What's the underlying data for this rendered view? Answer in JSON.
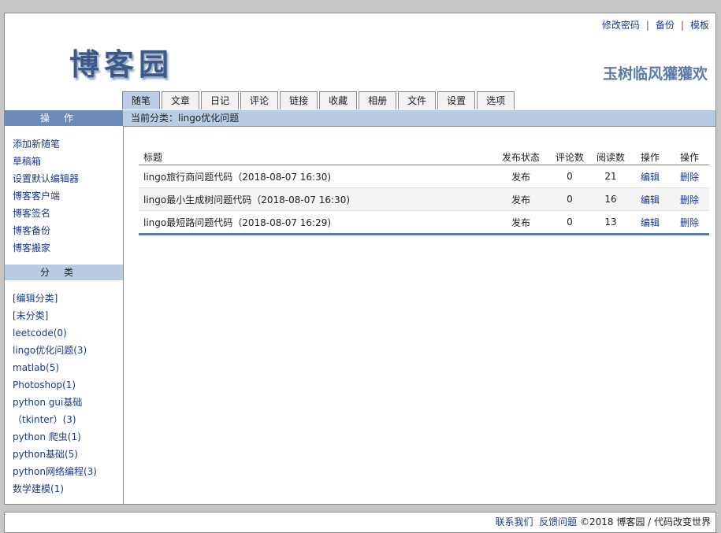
{
  "header": {
    "links": [
      "修改密码",
      "备份",
      "模板"
    ],
    "logo": "博客园",
    "blog_name": "玉树临风獾獾欢"
  },
  "tabs": [
    {
      "label": "随笔",
      "active": true
    },
    {
      "label": "文章"
    },
    {
      "label": "日记"
    },
    {
      "label": "评论"
    },
    {
      "label": "链接"
    },
    {
      "label": "收藏"
    },
    {
      "label": "相册"
    },
    {
      "label": "文件"
    },
    {
      "label": "设置"
    },
    {
      "label": "选项"
    }
  ],
  "sidebar": {
    "ops_header": "操作",
    "ops": [
      "添加新随笔",
      "草稿箱",
      "设置默认编辑器",
      "博客客户端",
      "博客签名",
      "博客备份",
      "博客搬家"
    ],
    "cat_header": "分类",
    "cats": [
      "[编辑分类]",
      "[未分类]",
      "leetcode(0)",
      "lingo优化问题(3)",
      "matlab(5)",
      "Photoshop(1)",
      "python gui基础",
      "（tkinter）(3)",
      "python 爬虫(1)",
      "python基础(5)",
      "python网络编程(3)",
      "数学建模(1)"
    ]
  },
  "crumb": "当前分类：lingo优化问题",
  "table": {
    "headers": [
      "标题",
      "发布状态",
      "评论数",
      "阅读数",
      "操作",
      "操作"
    ],
    "rows": [
      {
        "title": "lingo旅行商问题代码（2018-08-07 16:30)",
        "status": "发布",
        "comments": "0",
        "reads": "21",
        "edit": "编辑",
        "delete": "删除"
      },
      {
        "title": "lingo最小生成树问题代码（2018-08-07 16:30)",
        "status": "发布",
        "comments": "0",
        "reads": "16",
        "edit": "编辑",
        "delete": "删除"
      },
      {
        "title": "lingo最短路问题代码（2018-08-07 16:29)",
        "status": "发布",
        "comments": "0",
        "reads": "13",
        "edit": "编辑",
        "delete": "删除"
      }
    ]
  },
  "footer": {
    "contact": "联系我们",
    "feedback": "反馈问题",
    "copyright": "©2018 博客园 / 代码改变世界"
  }
}
